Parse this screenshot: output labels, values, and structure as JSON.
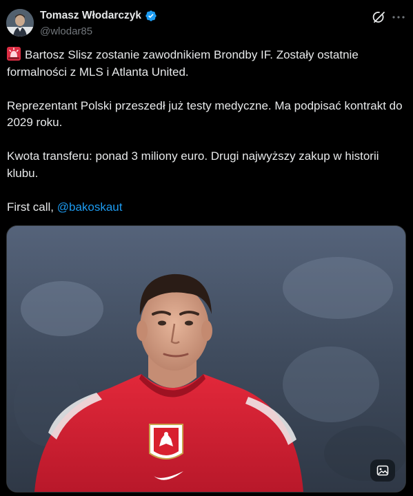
{
  "author": {
    "display_name": "Tomasz Włodarczyk",
    "handle": "@wlodar85",
    "verified_icon": "verified-badge-icon",
    "avatar_icon": "profile-avatar"
  },
  "actions": {
    "grok_icon": "grok-icon",
    "more_icon": "more-options-icon"
  },
  "tweet": {
    "emoji_icon": "police-siren-icon",
    "para1": "Bartosz Slisz zostanie zawodnikiem Brondby IF. Zostały ostatnie formalności z MLS i Atlanta United.",
    "para2": "Reprezentant Polski przeszedł już testy medyczne. Ma podpisać kontrakt do 2029 roku.",
    "para3": "Kwota transferu: ponad 3 miliony euro. Drugi najwyższy zakup w historii klubu.",
    "para4_prefix": "First call, ",
    "mention": "@bakoskaut"
  },
  "media": {
    "alt_icon": "image-description-icon"
  },
  "colors": {
    "background": "#000000",
    "text": "#e7e9ea",
    "secondary_text": "#71767b",
    "link": "#1d9bf0",
    "verified": "#1d9bf0",
    "jersey_red": "#d8202f"
  }
}
